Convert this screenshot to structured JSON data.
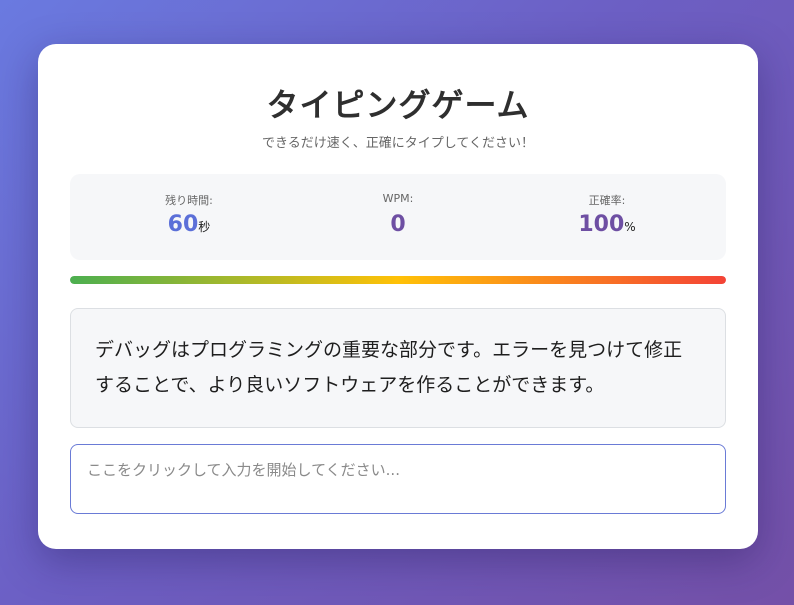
{
  "header": {
    "title": "タイピングゲーム",
    "subtitle": "できるだけ速く、正確にタイプしてください！"
  },
  "stats": {
    "time": {
      "label": "残り時間:",
      "value": "60",
      "unit": "秒",
      "color": "#5b6fd8"
    },
    "wpm": {
      "label": "WPM:",
      "value": "0",
      "color": "#6e4fa3"
    },
    "accuracy": {
      "label": "正確率:",
      "value": "100",
      "unit": "%",
      "color": "#6e4fa3"
    }
  },
  "progress": {
    "fraction": 1.0,
    "colors": [
      "#4caf50",
      "#ffc107",
      "#f44336"
    ]
  },
  "target_text": "デバッグはプログラミングの重要な部分です。エラーを見つけて修正することで、より良いソフトウェアを作ることができます。",
  "input": {
    "value": "",
    "placeholder": "ここをクリックして入力を開始してください..."
  }
}
